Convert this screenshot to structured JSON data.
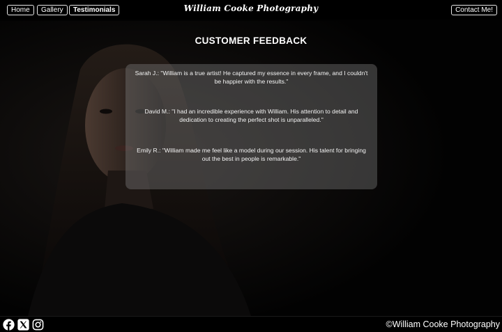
{
  "nav": {
    "home_label": "Home",
    "gallery_label": "Gallery",
    "testimonials_label": "Testimonials",
    "contact_label": "Contact Me!",
    "brand": "William Cooke Photography"
  },
  "main": {
    "heading": "CUSTOMER FEEDBACK",
    "testimonials": [
      {
        "text": "Sarah J.: \"William is a true artist! He captured my essence in every frame, and I couldn't be happier with the results.\""
      },
      {
        "text": "David M.: \"I had an incredible experience with William. His attention to detail and dedication to creating the perfect shot is unparalleled.\""
      },
      {
        "text": "Emily R.: \"William made me feel like a model during our session. His talent for bringing out the best in people is remarkable.\""
      }
    ]
  },
  "footer": {
    "social_icons": [
      "facebook-icon",
      "x-icon",
      "instagram-icon"
    ],
    "copyright": "©William Cooke Photography"
  },
  "colors": {
    "background": "#000000",
    "card_overlay": "rgba(128,128,128,0.40)",
    "text": "#ffffff"
  }
}
